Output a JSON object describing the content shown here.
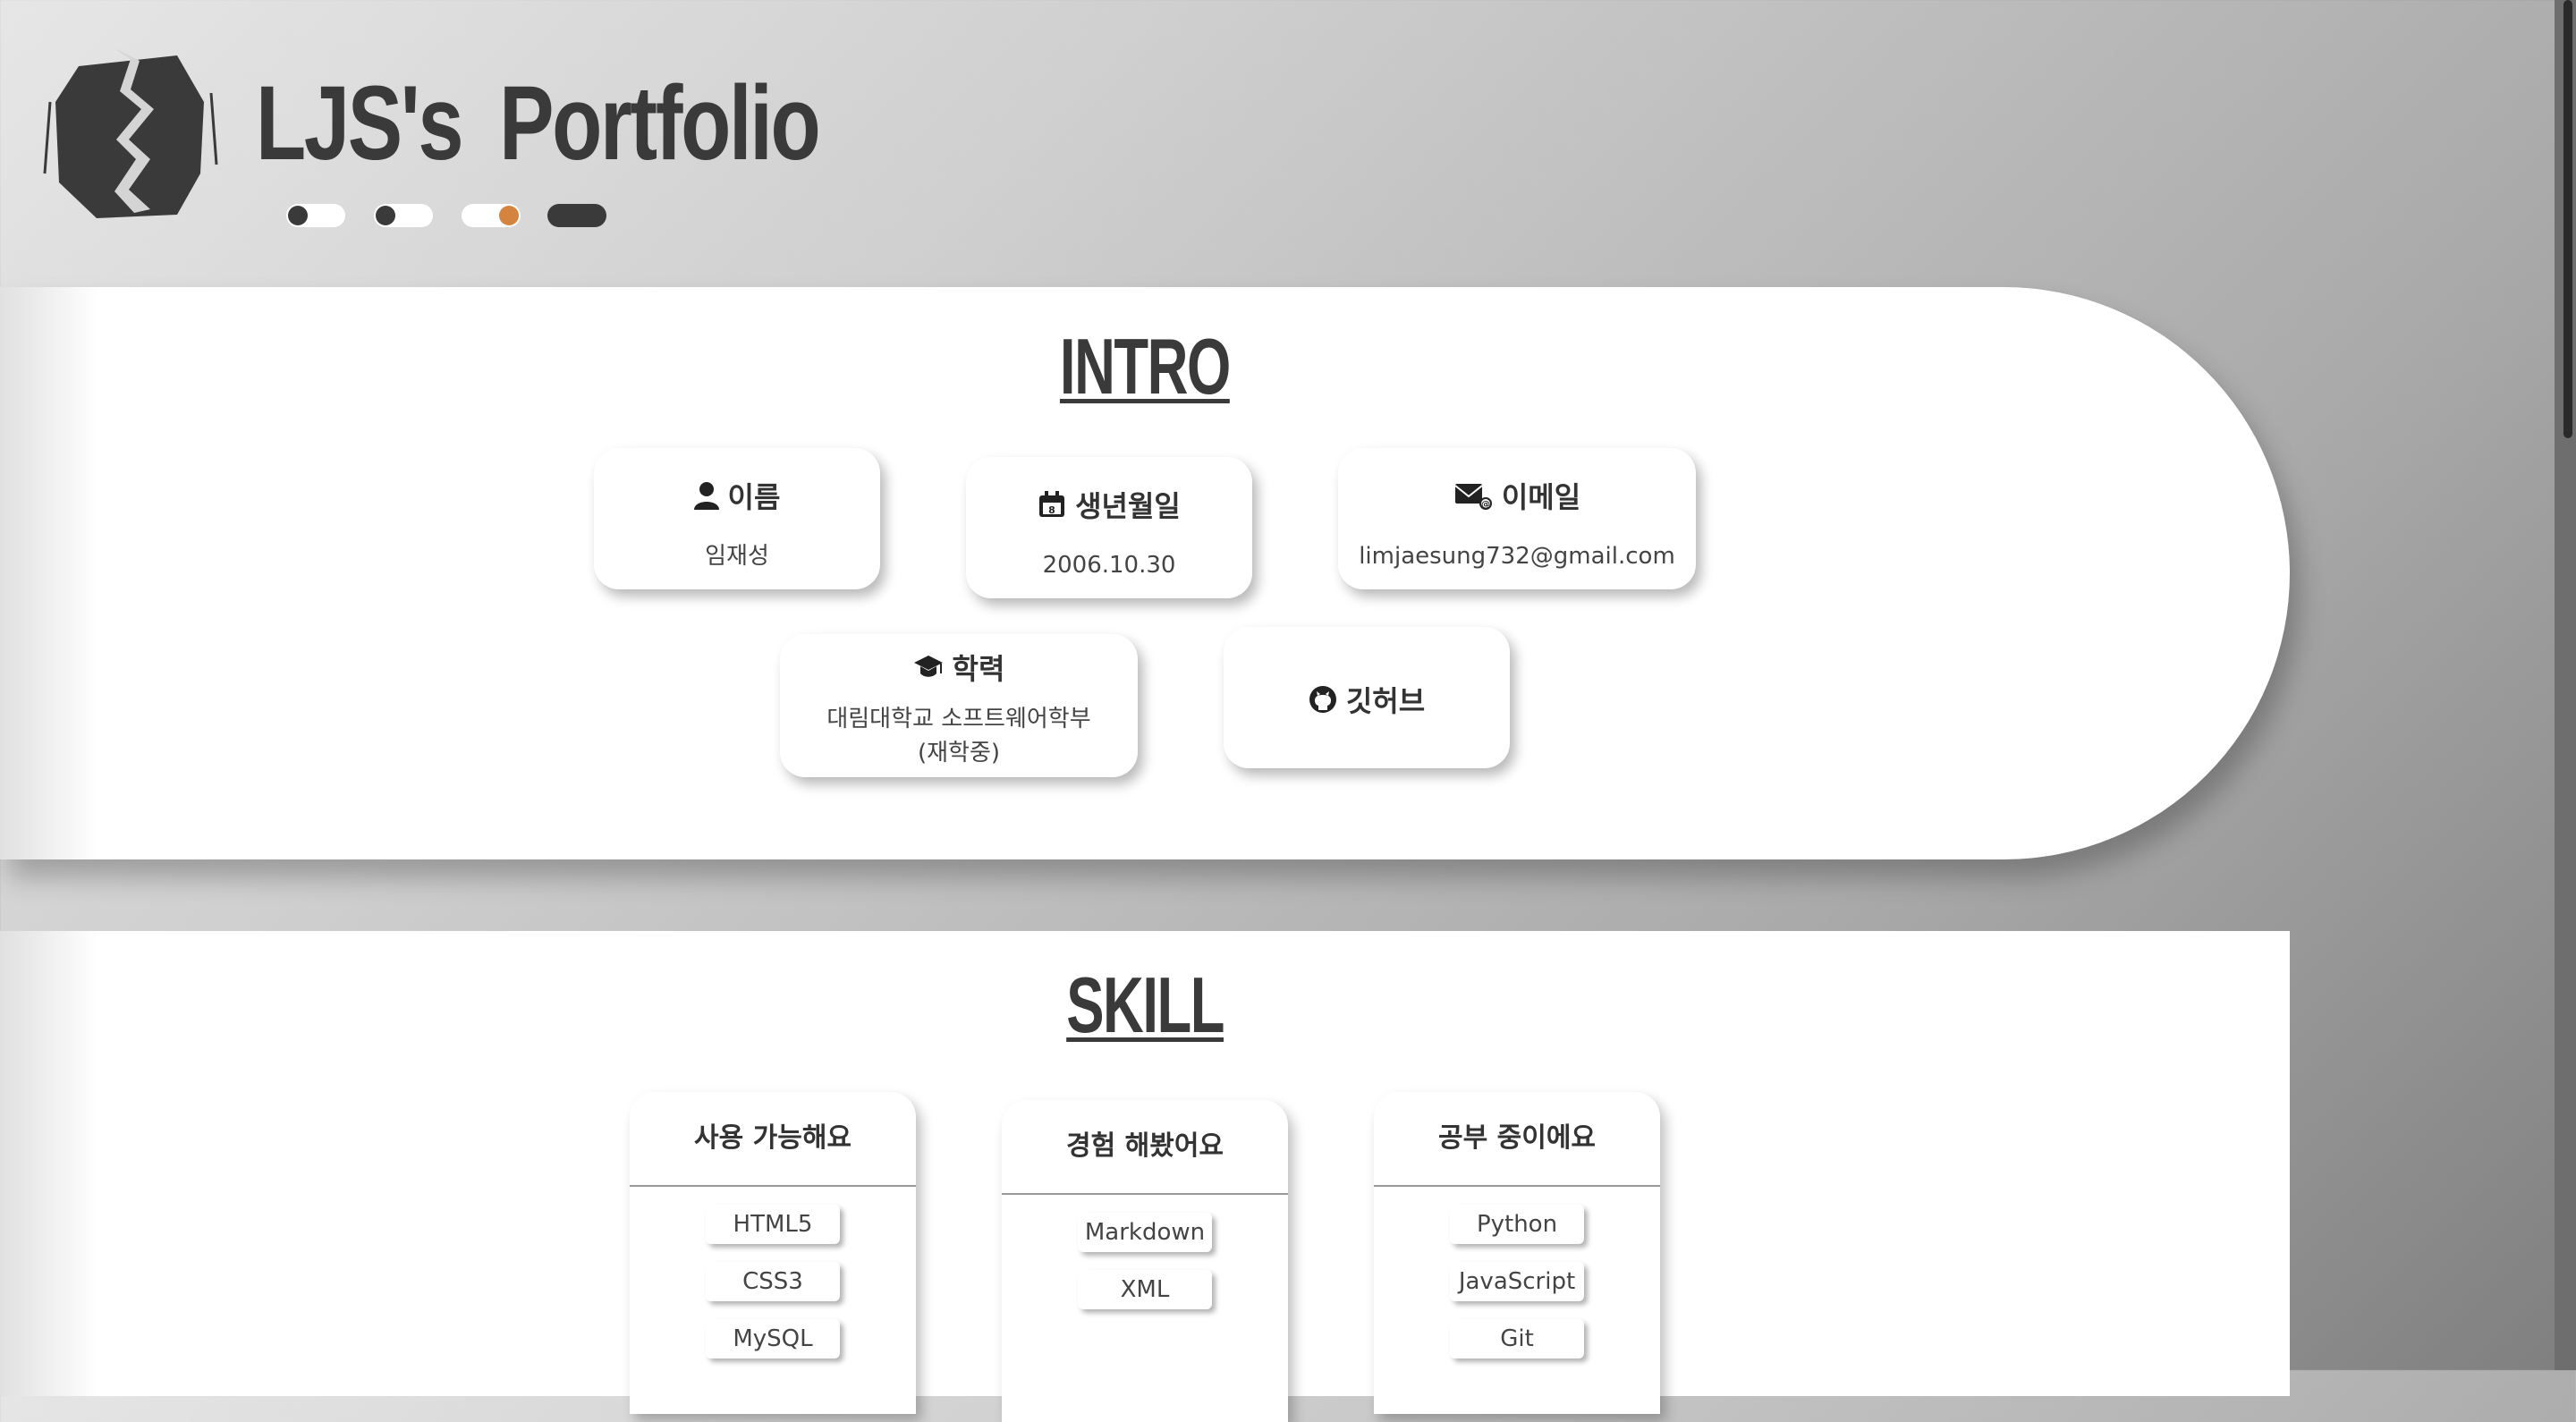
{
  "header": {
    "title": "LJS's  Portfolio",
    "logo_icon": "lightning-crack-logo",
    "toggles": [
      {
        "name": "toggle-1",
        "state": "off"
      },
      {
        "name": "toggle-2",
        "state": "off"
      },
      {
        "name": "toggle-3",
        "state": "on",
        "accent": "#d4843e"
      },
      {
        "name": "toggle-4",
        "state": "dark"
      }
    ]
  },
  "intro": {
    "title": "INTRO",
    "cards": {
      "name": {
        "label": "이름",
        "value": "임재성",
        "icon": "user-icon"
      },
      "birth": {
        "label": "생년월일",
        "value": "2006.10.30",
        "icon": "calendar-icon"
      },
      "email": {
        "label": "이메일",
        "value": "limjaesung732@gmail.com",
        "icon": "mail-icon"
      },
      "education": {
        "label": "학력",
        "value_line1": "대림대학교 소프트웨어학부",
        "value_line2": "(재학중)",
        "icon": "graduation-cap-icon"
      },
      "github": {
        "label": "깃허브",
        "icon": "github-icon"
      }
    }
  },
  "skill": {
    "title": "SKILL",
    "columns": [
      {
        "title": "사용 가능해요",
        "items": [
          "HTML5",
          "CSS3",
          "MySQL"
        ]
      },
      {
        "title": "경험 해봤어요",
        "items": [
          "Markdown",
          "XML"
        ]
      },
      {
        "title": "공부 중이에요",
        "items": [
          "Python",
          "JavaScript",
          "Git"
        ]
      }
    ]
  },
  "colors": {
    "accent": "#d4843e",
    "dark": "#3a3a3a",
    "card": "#ffffff"
  }
}
